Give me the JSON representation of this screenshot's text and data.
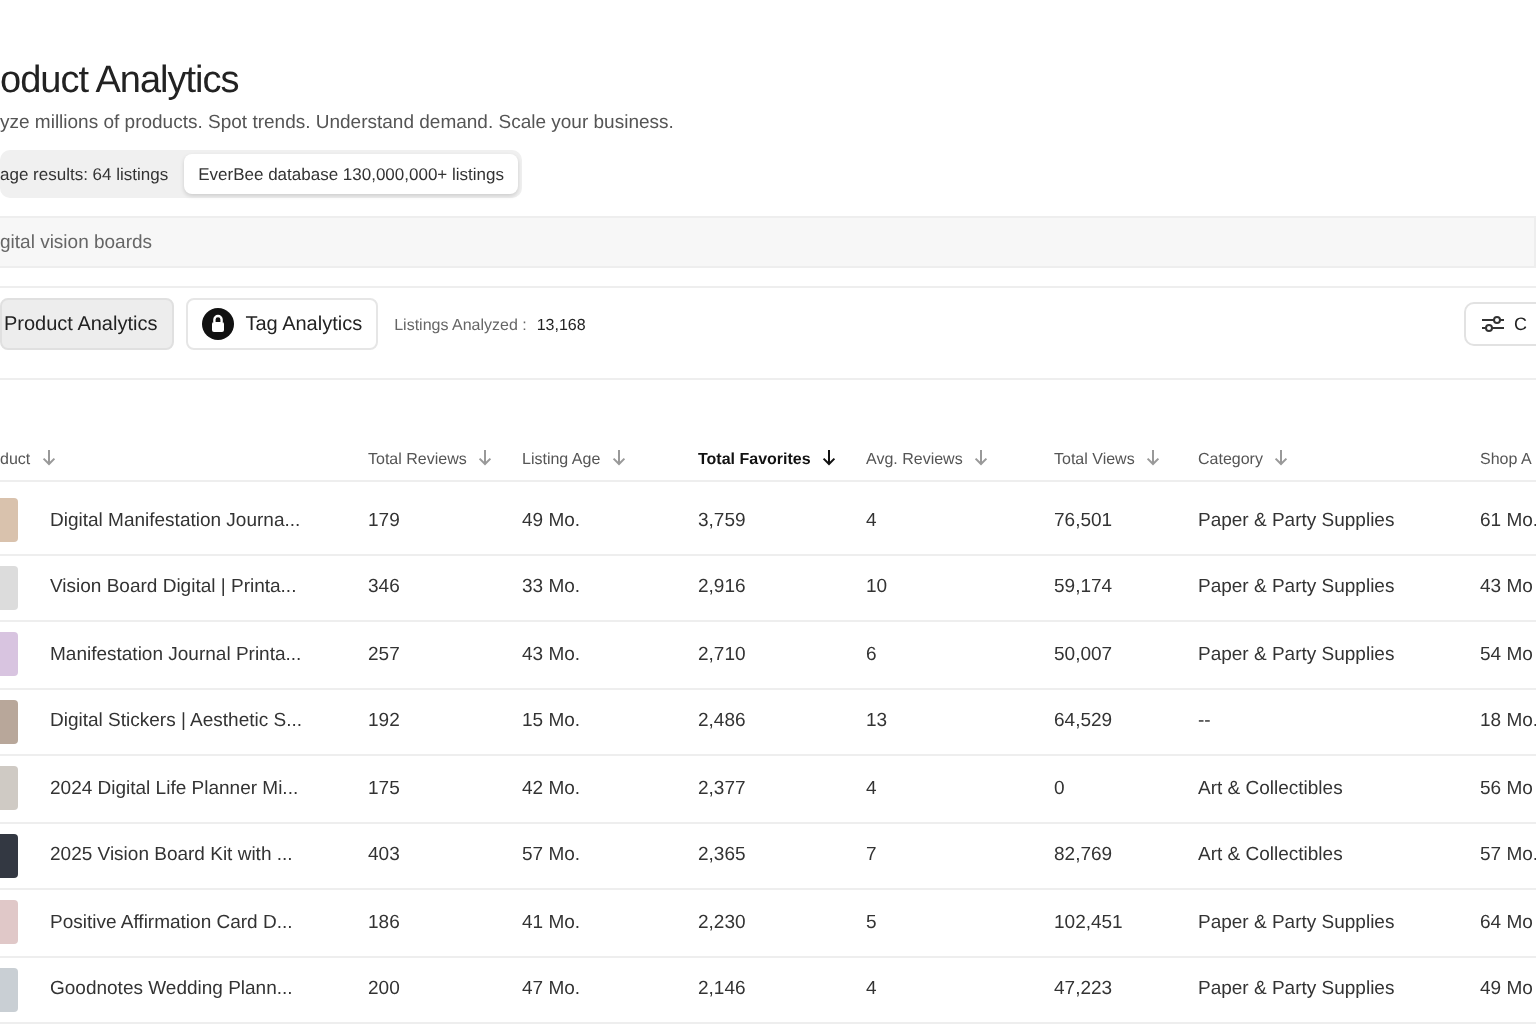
{
  "header": {
    "title": "oduct Analytics",
    "subtitle": "yze millions of products. Spot trends. Understand demand. Scale your business."
  },
  "scope": [
    {
      "label": "age results: 64 listings",
      "selected": false
    },
    {
      "label": "EverBee database 130,000,000+ listings",
      "selected": true
    }
  ],
  "search": {
    "value": "gital vision boards"
  },
  "tabs": [
    {
      "label": "Product Analytics",
      "selected": true,
      "locked": false
    },
    {
      "label": "Tag Analytics",
      "selected": false,
      "locked": true
    }
  ],
  "listings_analyzed": {
    "label": "Listings Analyzed :",
    "value": "13,168"
  },
  "columns_button": {
    "label": "C"
  },
  "table": {
    "columns": [
      {
        "label": "duct",
        "selected": false
      },
      {
        "label": "Total Reviews",
        "selected": false
      },
      {
        "label": "Listing Age",
        "selected": false
      },
      {
        "label": "Total Favorites",
        "selected": true
      },
      {
        "label": "Avg. Reviews",
        "selected": false
      },
      {
        "label": "Total Views",
        "selected": false
      },
      {
        "label": "Category",
        "selected": false
      },
      {
        "label": "Shop A",
        "selected": false
      }
    ],
    "rows": [
      [
        "Digital Manifestation Journa...",
        "179",
        "49 Mo.",
        "3,759",
        "4",
        "76,501",
        "Paper & Party Supplies",
        "61 Mo."
      ],
      [
        "Vision Board Digital | Printa...",
        "346",
        "33 Mo.",
        "2,916",
        "10",
        "59,174",
        "Paper & Party Supplies",
        "43 Mo"
      ],
      [
        "Manifestation Journal Printa...",
        "257",
        "43 Mo.",
        "2,710",
        "6",
        "50,007",
        "Paper & Party Supplies",
        "54 Mo"
      ],
      [
        "Digital Stickers | Aesthetic S...",
        "192",
        "15 Mo.",
        "2,486",
        "13",
        "64,529",
        "--",
        "18 Mo."
      ],
      [
        "2024 Digital Life Planner Mi...",
        "175",
        "42 Mo.",
        "2,377",
        "4",
        "0",
        "Art & Collectibles",
        "56 Mo"
      ],
      [
        "2025 Vision Board Kit with ...",
        "403",
        "57 Mo.",
        "2,365",
        "7",
        "82,769",
        "Art & Collectibles",
        "57 Mo."
      ],
      [
        "Positive Affirmation Card D...",
        "186",
        "41 Mo.",
        "2,230",
        "5",
        "102,451",
        "Paper & Party Supplies",
        "64 Mo"
      ],
      [
        "Goodnotes Wedding Plann...",
        "200",
        "47 Mo.",
        "2,146",
        "4",
        "47,223",
        "Paper & Party Supplies",
        "49 Mo"
      ]
    ]
  }
}
